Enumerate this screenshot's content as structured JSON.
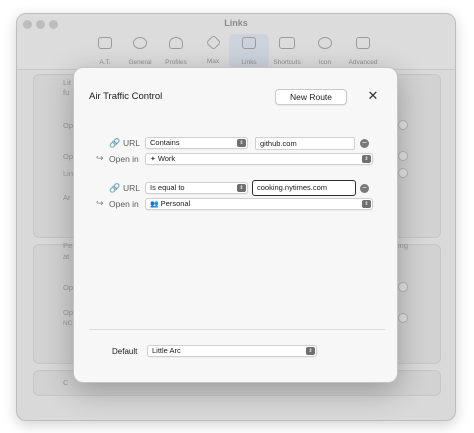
{
  "window": {
    "title": "Links",
    "toolbar": [
      {
        "label": "A.T.",
        "icon": "at-icon"
      },
      {
        "label": "General",
        "icon": "gear-icon"
      },
      {
        "label": "Profiles",
        "icon": "person-icon"
      },
      {
        "label": "Max",
        "icon": "sparkle-icon"
      },
      {
        "label": "Links",
        "icon": "window-icon",
        "active": true
      },
      {
        "label": "Shortcuts",
        "icon": "keyboard-icon"
      },
      {
        "label": "Icon",
        "icon": "palette-icon"
      },
      {
        "label": "Advanced",
        "icon": "sliders-icon"
      }
    ],
    "background_fragments": [
      "Lit",
      "fu",
      "Op",
      "Op",
      "Lin",
      "Ar",
      "Pe",
      "at",
      "ing",
      "Op",
      "Op",
      "NC",
      "C"
    ]
  },
  "dialog": {
    "title": "Air Traffic Control",
    "new_route_label": "New Route",
    "close_icon": "close-icon",
    "rules": [
      {
        "url_label": "URL",
        "url_icon": "link-icon",
        "condition": "Contains",
        "value": "github.com",
        "open_in_label": "Open in",
        "open_in_icon": "return-arrow-icon",
        "profile": "Work",
        "profile_icon": "work-profile-icon"
      },
      {
        "url_label": "URL",
        "url_icon": "link-icon",
        "condition": "Is equal to",
        "value": "cooking.nytimes.com",
        "open_in_label": "Open in",
        "open_in_icon": "return-arrow-icon",
        "profile": "Personal",
        "profile_icon": "people-icon"
      }
    ],
    "default_label": "Default",
    "default_value": "Little Arc"
  }
}
